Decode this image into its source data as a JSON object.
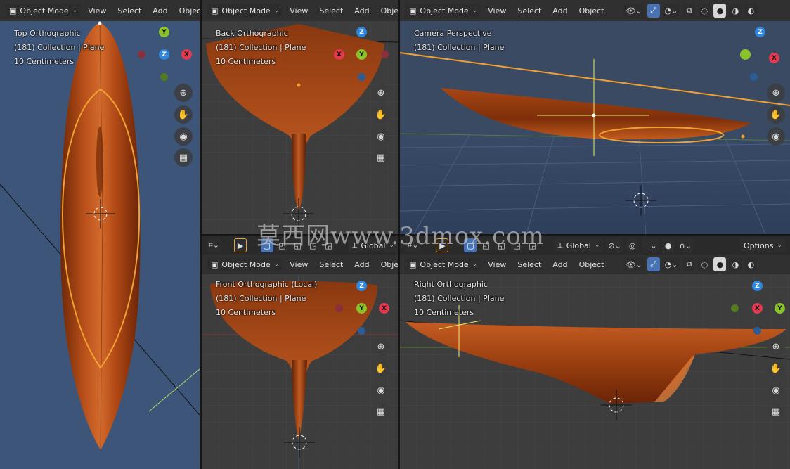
{
  "colors": {
    "accent_orange": "#f0a132",
    "x_axis": "#e4394f",
    "y_axis": "#8ac42a",
    "z_axis": "#2f86dd",
    "mesh": "#b44a12",
    "header_bg": "#303030",
    "ortho_bg": "#3d3d3d",
    "top_bg": "#3d5579"
  },
  "header": {
    "mode": "Object Mode",
    "menu": [
      "View",
      "Select",
      "Add",
      "Object"
    ]
  },
  "tool_header": {
    "orientation": "Global",
    "options_label": "Options"
  },
  "viewports": {
    "top": {
      "title": "Top Orthographic",
      "collection": "(181) Collection | Plane",
      "scale": "10 Centimeters"
    },
    "back": {
      "title": "Back Orthographic",
      "collection": "(181) Collection | Plane",
      "scale": "10 Centimeters"
    },
    "camera": {
      "title": "Camera Perspective",
      "collection": "(181) Collection | Plane"
    },
    "front": {
      "title": "Front Orthographic (Local)",
      "collection": "(181) Collection | Plane",
      "scale": "10 Centimeters"
    },
    "right": {
      "title": "Right Orthographic",
      "collection": "(181) Collection | Plane",
      "scale": "10 Centimeters"
    }
  },
  "gizmo_labels": {
    "x": "X",
    "y": "Y",
    "z": "Z"
  },
  "nav_icons": [
    "zoom-icon",
    "hand-pan-icon",
    "camera-icon",
    "grid-ortho-icon"
  ],
  "watermark": "莫西网www.3dmox.com"
}
